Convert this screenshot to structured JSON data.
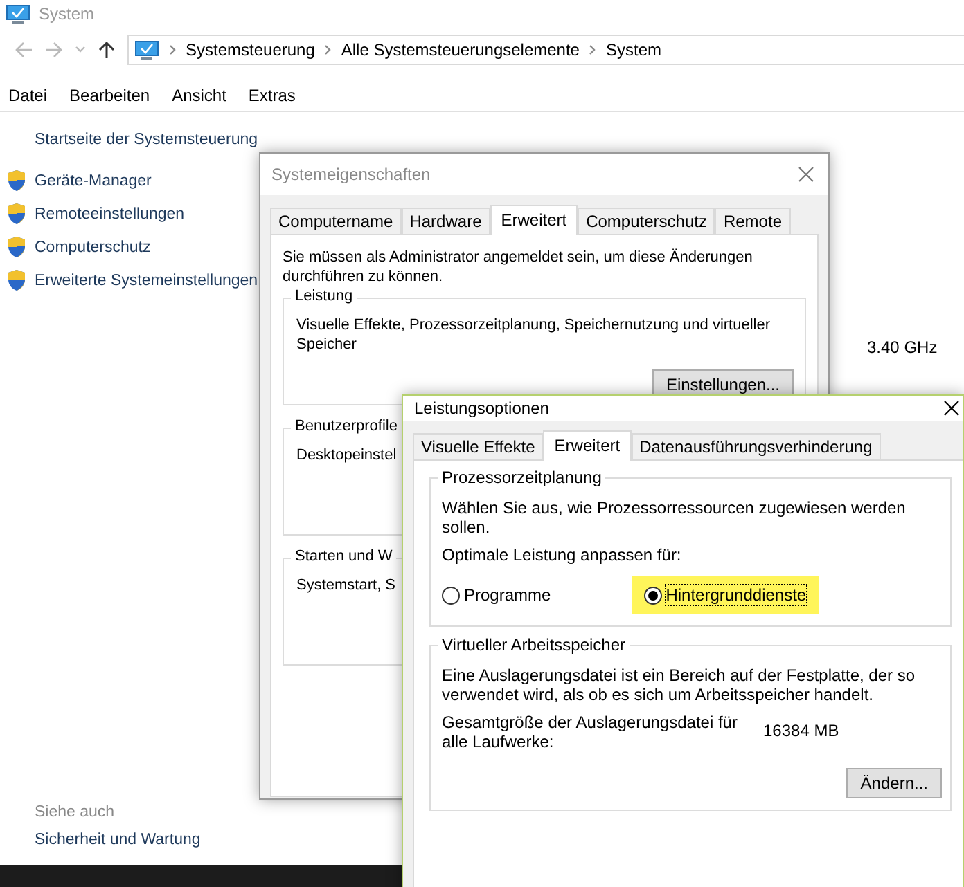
{
  "window": {
    "title": "System"
  },
  "address_bar": {
    "crumbs": [
      "Systemsteuerung",
      "Alle Systemsteuerungselemente",
      "System"
    ]
  },
  "menu": [
    "Datei",
    "Bearbeiten",
    "Ansicht",
    "Extras"
  ],
  "sidebar": {
    "home": "Startseite der Systemsteuerung",
    "items": [
      "Geräte-Manager",
      "Remoteeinstellungen",
      "Computerschutz",
      "Erweiterte Systemeinstellungen"
    ],
    "see_also_title": "Siehe auch",
    "see_also": [
      "Sicherheit und Wartung"
    ]
  },
  "content": {
    "processor_speed": "3.40 GHz"
  },
  "system_properties": {
    "title": "Systemeigenschaften",
    "tabs": [
      {
        "label": "Computername",
        "selected": false
      },
      {
        "label": "Hardware",
        "selected": false
      },
      {
        "label": "Erweitert",
        "selected": true
      },
      {
        "label": "Computerschutz",
        "selected": false
      },
      {
        "label": "Remote",
        "selected": false
      }
    ],
    "note": "Sie müssen als Administrator angemeldet sein, um diese Änderungen durchführen zu können.",
    "groups": [
      {
        "title": "Leistung",
        "text": "Visuelle Effekte, Prozessorzeitplanung, Speichernutzung und virtueller Speicher",
        "button": "Einstellungen..."
      },
      {
        "title": "Benutzerprofile",
        "text": "Desktopeinstel"
      },
      {
        "title": "Starten und W",
        "text": "Systemstart, S"
      }
    ]
  },
  "performance_options": {
    "title": "Leistungsoptionen",
    "tabs": [
      {
        "label": "Visuelle Effekte",
        "selected": false
      },
      {
        "label": "Erweitert",
        "selected": true
      },
      {
        "label": "Datenausführungsverhinderung",
        "selected": false
      }
    ],
    "scheduling": {
      "title": "Prozessorzeitplanung",
      "text": "Wählen Sie aus, wie Prozessorressourcen zugewiesen werden sollen.",
      "prompt": "Optimale Leistung anpassen für:",
      "options": [
        {
          "label": "Programme",
          "selected": false,
          "highlighted": false
        },
        {
          "label": "Hintergrunddienste",
          "selected": true,
          "highlighted": true
        }
      ]
    },
    "virtual_memory": {
      "title": "Virtueller Arbeitsspeicher",
      "text": "Eine Auslagerungsdatei ist ein Bereich auf der Festplatte, der so verwendet wird, als ob es sich um Arbeitsspeicher handelt.",
      "total_label": "Gesamtgröße der Auslagerungsdatei für alle Laufwerke:",
      "total_value": "16384 MB",
      "button": "Ändern..."
    }
  }
}
